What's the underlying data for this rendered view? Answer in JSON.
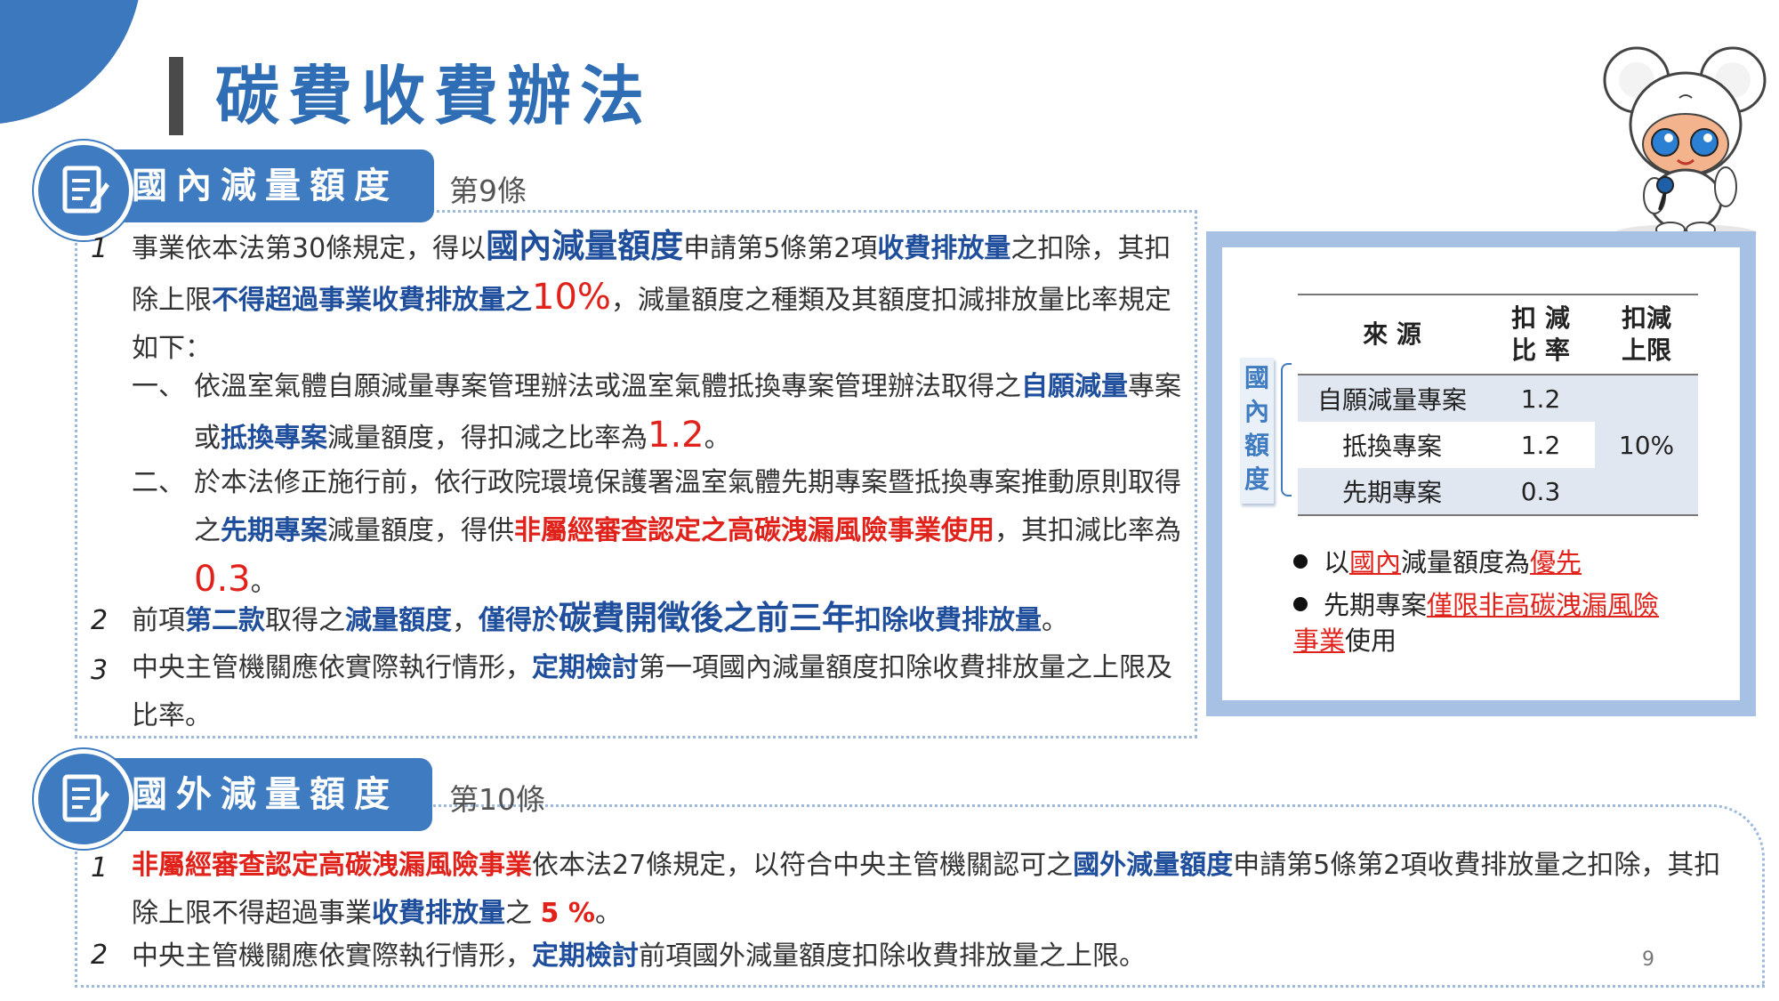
{
  "title": "碳費收費辦法",
  "sections": [
    {
      "heading": "國內減量額度",
      "article": "第9條"
    },
    {
      "heading": "國外減量額度",
      "article": "第10條"
    }
  ],
  "domestic": {
    "p1": {
      "num": "1",
      "t1": "事業依本法第30條規定，得以",
      "b1": "國內減量額度",
      "t2": "申請第5條第2項",
      "b2": "收費排放量",
      "t3": "之扣除，其扣除上限",
      "r1": "不得超過事業收費排放量之",
      "r2": "10%",
      "t4": "，減量額度之種類及其額度扣減排放量比率規定如下："
    },
    "item1": {
      "mark": "一、",
      "t1": "依溫室氣體自願減量專案管理辦法或溫室氣體抵換專案管理辦法取得之",
      "b1": "自願減量",
      "t2": "專案或",
      "b2": "抵換專案",
      "t3": "減量額度，得扣減之比率為",
      "r1": "1.2",
      "t4": "。"
    },
    "item2": {
      "mark": "二、",
      "t1": "於本法修正施行前，依行政院環境保護署溫室氣體先期專案暨抵換專案推動原則取得之",
      "b1": "先期專案",
      "t2": "減量額度，得供",
      "r1": "非屬經審查認定之高碳洩漏風險事業使用",
      "t3": "，其扣減比率為",
      "r2": "0.3",
      "t4": "。"
    },
    "p2": {
      "num": "2",
      "t1": "前項",
      "b1": "第二款",
      "t2": "取得之",
      "b2": "減量額度",
      "t3": "，",
      "b3": "僅得於",
      "b4": "碳費開徵後之前三年",
      "b5": "扣除收費排放量",
      "t4": "。"
    },
    "p3": {
      "num": "3",
      "t1": "中央主管機關應依實際執行情形，",
      "b1": "定期檢討",
      "t2": "第一項國內減量額度扣除收費排放量之上限及比率。"
    }
  },
  "foreign": {
    "p1": {
      "num": "1",
      "r1": "非屬經審查認定高碳洩漏風險事業",
      "t1": "依本法27條規定，以符合中央主管機關認可之",
      "b1": "國外減量額度",
      "t2": "申請第5條第2項收費排放量之扣除，其扣除上限不得超過事業",
      "b2": "收費排放量",
      "t3": "之 ",
      "r2": "5 %",
      "t4": "。"
    },
    "p2": {
      "num": "2",
      "t1": "中央主管機關應依實際執行情形，",
      "b1": "定期檢討",
      "t2": "前項國外減量額度扣除收費排放量之上限。"
    }
  },
  "table": {
    "label": "國內額度",
    "headers": [
      "來 源",
      "扣 減\n比 率",
      "扣減\n上限"
    ],
    "rows": [
      {
        "source": "自願減量專案",
        "rate": "1.2"
      },
      {
        "source": "抵換專案",
        "rate": "1.2"
      },
      {
        "source": "先期專案",
        "rate": "0.3"
      }
    ],
    "cap": "10%"
  },
  "bullets": {
    "b1": {
      "t1": "以",
      "u1": "國內",
      "t2": "減量額度為",
      "u2": "優先"
    },
    "b2": {
      "t1": "先期專案",
      "u1": "僅限非高碳洩漏風險事業",
      "t2": "使用"
    }
  },
  "page_number": "9",
  "colors": {
    "primary": "#3f7bc0",
    "title": "#2f6db5",
    "emphasis_blue": "#1f4e9c",
    "emphasis_red": "#e0221b",
    "panel": "#a6c1e3"
  },
  "icons": [
    "document-edit-icon",
    "mascot"
  ]
}
